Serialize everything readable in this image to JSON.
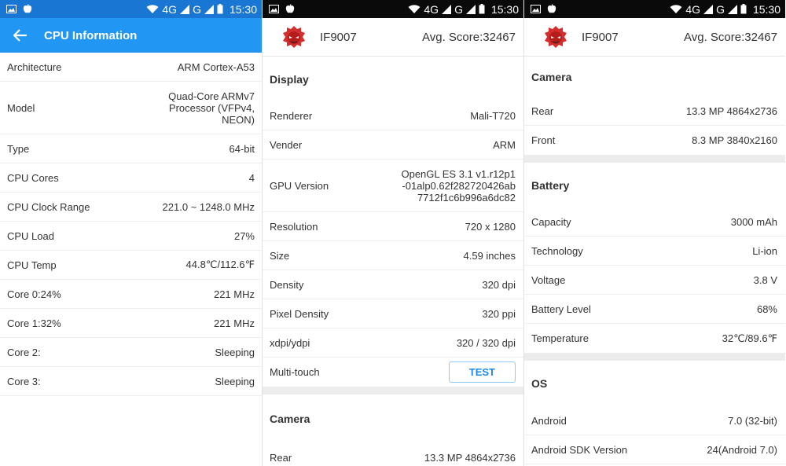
{
  "status": {
    "network_4g": "4G",
    "network_g": "G",
    "time": "15:30"
  },
  "screen1": {
    "appbar_title": "CPU Information",
    "rows": [
      {
        "label": "Architecture",
        "value": "ARM Cortex-A53"
      },
      {
        "label": "Model",
        "value": "Quad-Core ARMv7 Processor (VFPv4, NEON)"
      },
      {
        "label": "Type",
        "value": "64-bit"
      },
      {
        "label": "CPU Cores",
        "value": "4"
      },
      {
        "label": "CPU Clock Range",
        "value": "221.0 ~ 1248.0 MHz"
      },
      {
        "label": "CPU Load",
        "value": "27%"
      },
      {
        "label": "CPU Temp",
        "value": "44.8℃/112.6℉"
      },
      {
        "label": "Core 0:24%",
        "value": "221 MHz"
      },
      {
        "label": "Core 1:32%",
        "value": "221 MHz"
      },
      {
        "label": "Core 2:",
        "value": "Sleeping"
      },
      {
        "label": "Core 3:",
        "value": "Sleeping"
      }
    ],
    "model_lines": [
      "Quad-Core ARMv7",
      "Processor (VFPv4,",
      "NEON)"
    ]
  },
  "device": {
    "model": "IF9007",
    "score": "Avg. Score:32467"
  },
  "screen2": {
    "display_title": "Display",
    "display_rows": [
      {
        "label": "Renderer",
        "value": "Mali-T720"
      },
      {
        "label": "Vender",
        "value": "ARM"
      },
      {
        "label": "GPU Version",
        "value": "OpenGL ES 3.1 v1.r12p1-01alp0.62f282720426ab7712f1c6b996a6dc82"
      },
      {
        "label": "Resolution",
        "value": "720 x 1280"
      },
      {
        "label": "Size",
        "value": "4.59 inches"
      },
      {
        "label": "Density",
        "value": "320 dpi"
      },
      {
        "label": "Pixel Density",
        "value": "320 ppi"
      },
      {
        "label": "xdpi/ydpi",
        "value": "320 / 320 dpi"
      },
      {
        "label": "Multi-touch",
        "value": ""
      }
    ],
    "gpu_lines": [
      "OpenGL ES 3.1 v1.r12p1",
      "-01alp0.62f282720426ab",
      "7712f1c6b996a6dc82"
    ],
    "test_button": "TEST",
    "camera_title": "Camera",
    "camera_rows": [
      {
        "label": "Rear",
        "value": "13.3 MP 4864x2736"
      }
    ]
  },
  "screen3": {
    "camera_title": "Camera",
    "camera_rows": [
      {
        "label": "Rear",
        "value": "13.3 MP 4864x2736"
      },
      {
        "label": "Front",
        "value": "8.3 MP 3840x2160"
      }
    ],
    "battery_title": "Battery",
    "battery_rows": [
      {
        "label": "Capacity",
        "value": "3000 mAh"
      },
      {
        "label": "Technology",
        "value": "Li-ion"
      },
      {
        "label": "Voltage",
        "value": "3.8 V"
      },
      {
        "label": "Battery Level",
        "value": "68%"
      },
      {
        "label": "Temperature",
        "value": "32℃/89.6℉"
      }
    ],
    "os_title": "OS",
    "os_rows": [
      {
        "label": "Android",
        "value": "7.0 (32-bit)"
      },
      {
        "label": "Android SDK Version",
        "value": "24(Android 7.0)"
      }
    ]
  },
  "colors": {
    "appbar": "#2196f3",
    "statusbar_blue": "#1976d2",
    "statusbar_dark": "#0a0a0a",
    "accent": "#1e88e5",
    "logo_red": "#d32f2f"
  },
  "icons": [
    "back-arrow-icon",
    "image-icon",
    "apple-icon",
    "wifi-icon",
    "signal-icon",
    "battery-icon",
    "antutu-logo"
  ]
}
